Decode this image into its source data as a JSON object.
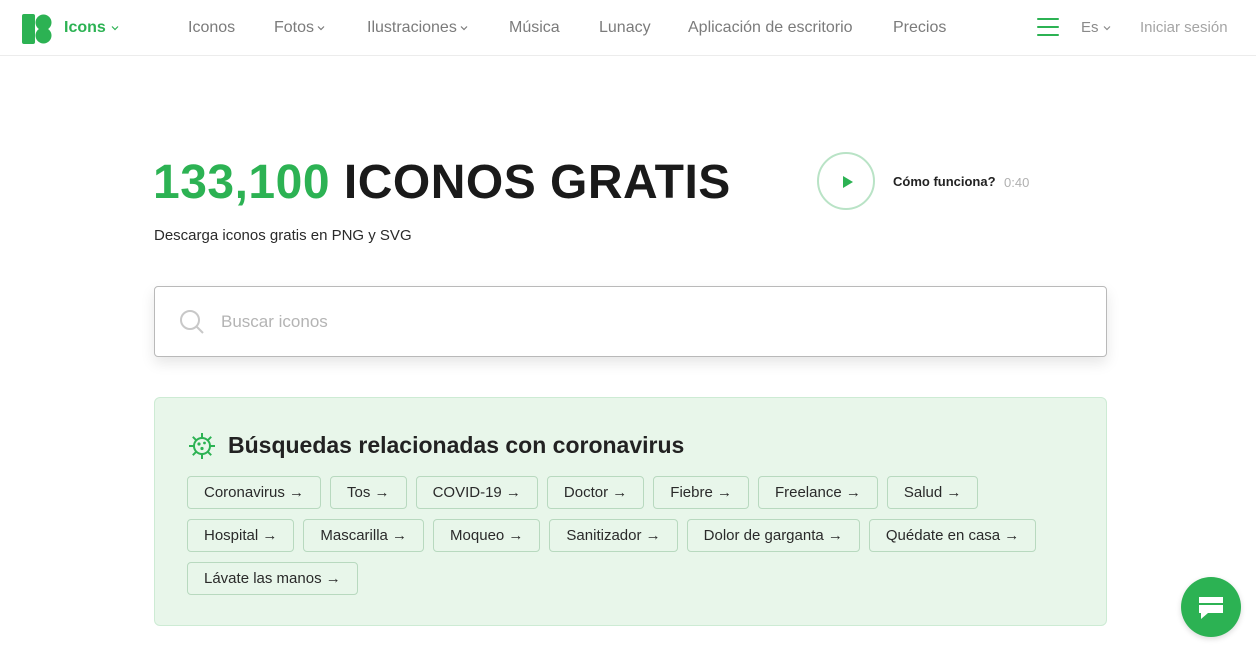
{
  "header": {
    "brand": "Icons",
    "nav": [
      {
        "label": "Iconos",
        "dropdown": false
      },
      {
        "label": "Fotos",
        "dropdown": true
      },
      {
        "label": "Ilustraciones",
        "dropdown": true
      },
      {
        "label": "Música",
        "dropdown": false
      },
      {
        "label": "Lunacy",
        "dropdown": false
      },
      {
        "label": "Aplicación de escritorio",
        "dropdown": false
      },
      {
        "label": "Precios",
        "dropdown": false
      }
    ],
    "language": "Es",
    "login": "Iniciar sesión",
    "icons": [
      "logo-icon",
      "chevron-down-icon",
      "menu-icon"
    ]
  },
  "hero": {
    "count": "133,100",
    "title_rest": "ICONOS GRATIS",
    "subtitle": "Descarga iconos gratis en PNG y SVG",
    "video_label": "Cómo funciona?",
    "video_duration": "0:40"
  },
  "search": {
    "placeholder": "Buscar iconos",
    "value": ""
  },
  "related": {
    "title": "Búsquedas relacionadas con coronavirus",
    "tags": [
      "Coronavirus →",
      "Tos →",
      "COVID-19 →",
      "Doctor →",
      "Fiebre →",
      "Freelance →",
      "Salud →",
      "Hospital →",
      "Mascarilla →",
      "Moqueo →",
      "Sanitizador →",
      "Dolor de garganta →",
      "Quédate en casa →",
      "Lávate las manos →"
    ]
  },
  "colors": {
    "accent": "#2cb253",
    "panel_bg": "#e8f6ea",
    "muted_text": "#7b7b7b"
  }
}
